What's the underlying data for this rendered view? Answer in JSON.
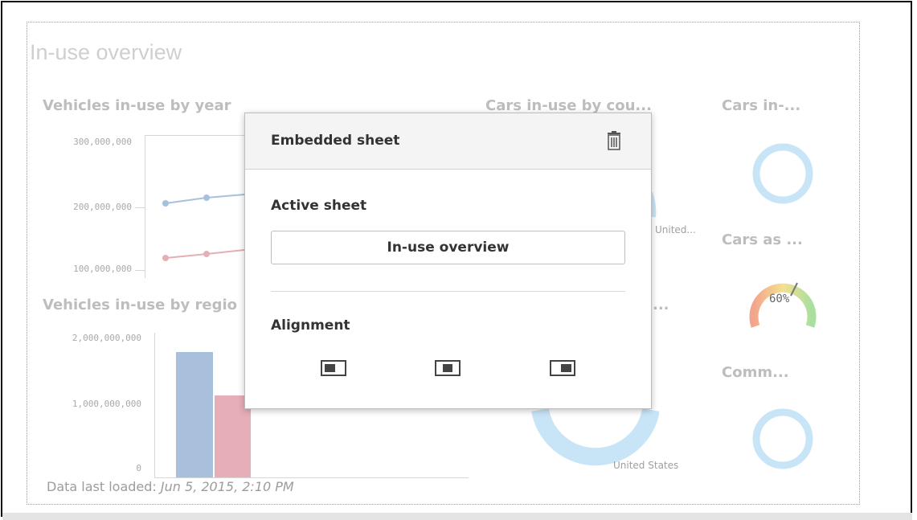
{
  "sheet": {
    "title": "In-use overview",
    "footer_label": "Data last loaded:",
    "footer_date": "Jun 5, 2015, 2:10 PM"
  },
  "charts": {
    "vehicles_by_year": {
      "title": "Vehicles in-use by year",
      "ticks": [
        "300,000,000",
        "200,000,000",
        "100,000,000"
      ]
    },
    "vehicles_by_region": {
      "title": "Vehicles in-use by regio",
      "ticks": [
        "2,000,000,000",
        "1,000,000,000",
        "0"
      ]
    },
    "cars_by_country": {
      "title": "Cars in-use by cou...",
      "labels": [
        "United...",
        "United States"
      ]
    },
    "cars_in": {
      "title": "Cars in-..."
    },
    "cars_as": {
      "title": "Cars as ...",
      "gauge_value": "60%"
    },
    "comm": {
      "title": "Comm..."
    },
    "hidden_title_fragment": "..."
  },
  "popover": {
    "title": "Embedded sheet",
    "active_sheet_label": "Active sheet",
    "active_sheet_value": "In-use overview",
    "alignment_label": "Alignment",
    "icons": {
      "delete": "trash-icon",
      "align_left": "align-left-icon",
      "align_center": "align-center-icon",
      "align_right": "align-right-icon"
    }
  },
  "colors": {
    "blue_series": "#a9c0dc",
    "pink_series": "#e6aeb6",
    "donut": "#c8e5f8"
  }
}
